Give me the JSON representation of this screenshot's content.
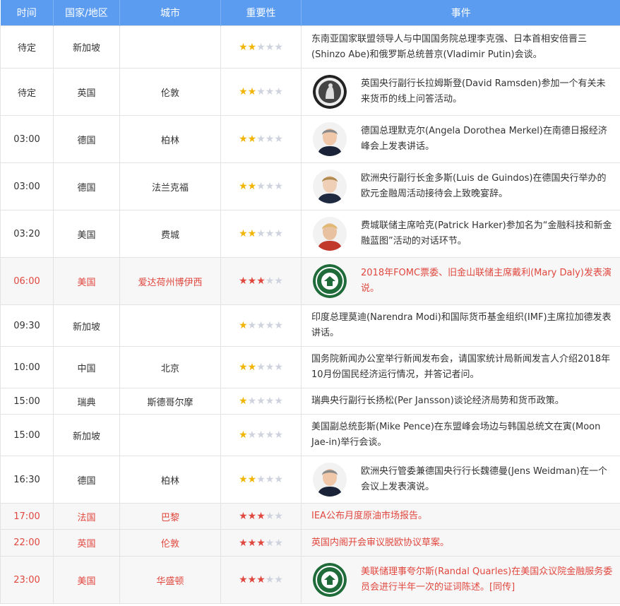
{
  "header": {
    "time": "时间",
    "country": "国家/地区",
    "city": "城市",
    "importance": "重要性",
    "event": "事件"
  },
  "colors": {
    "header_bg": "#5b9cf0",
    "highlight_text": "#e0473e",
    "star_yellow": "#f1b400",
    "star_red": "#e0473e",
    "star_gray": "#cfd3de"
  },
  "rows": [
    {
      "time": "待定",
      "country": "新加坡",
      "city": "",
      "stars": 2,
      "highlight": false,
      "avatar": "",
      "event": "东南亚国家联盟领导人与中国国务院总理李克强、日本首相安倍晋三(Shinzo Abe)和俄罗斯总统普京(Vladimir Putin)会谈。"
    },
    {
      "time": "待定",
      "country": "英国",
      "city": "伦敦",
      "stars": 2,
      "highlight": false,
      "avatar": "bank-of-england-logo-icon",
      "event": "英国央行副行长拉姆斯登(David Ramsden)参加一个有关未来货币的线上问答活动。"
    },
    {
      "time": "03:00",
      "country": "德国",
      "city": "柏林",
      "stars": 2,
      "highlight": false,
      "avatar": "person-photo-icon",
      "event": "德国总理默克尔(Angela Dorothea Merkel)在南德日报经济峰会上发表讲话。"
    },
    {
      "time": "03:00",
      "country": "德国",
      "city": "法兰克福",
      "stars": 2,
      "highlight": false,
      "avatar": "person-photo-icon",
      "event": "欧洲央行副行长金多斯(Luis de Guindos)在德国央行举办的欧元金融周活动接待会上致晚宴辞。"
    },
    {
      "time": "03:20",
      "country": "美国",
      "city": "费城",
      "stars": 2,
      "highlight": false,
      "avatar": "person-photo-icon",
      "event": "费城联储主席哈克(Patrick Harker)参加名为“金融科技和新金融蓝图”活动的对话环节。"
    },
    {
      "time": "06:00",
      "country": "美国",
      "city": "爱达荷州博伊西",
      "stars": 3,
      "highlight": true,
      "avatar": "federal-reserve-seal-icon",
      "event": "2018年FOMC票委、旧金山联储主席戴利(Mary Daly)发表演说。"
    },
    {
      "time": "09:30",
      "country": "新加坡",
      "city": "",
      "stars": 1,
      "highlight": false,
      "avatar": "",
      "event": "印度总理莫迪(Narendra Modi)和国际货币基金组织(IMF)主席拉加德发表讲话。"
    },
    {
      "time": "10:00",
      "country": "中国",
      "city": "北京",
      "stars": 2,
      "highlight": false,
      "avatar": "",
      "event": "国务院新闻办公室举行新闻发布会，请国家统计局新闻发言人介绍2018年10月份国民经济运行情况，并答记者问。"
    },
    {
      "time": "15:00",
      "country": "瑞典",
      "city": "斯德哥尔摩",
      "stars": 1,
      "highlight": false,
      "avatar": "",
      "event": "瑞典央行副行长扬松(Per Jansson)谈论经济局势和货币政策。"
    },
    {
      "time": "15:00",
      "country": "新加坡",
      "city": "",
      "stars": 1,
      "highlight": false,
      "avatar": "",
      "event": "美国副总统彭斯(Mike Pence)在东盟峰会场边与韩国总统文在寅(Moon Jae-in)举行会谈。"
    },
    {
      "time": "16:30",
      "country": "德国",
      "city": "柏林",
      "stars": 2,
      "highlight": false,
      "avatar": "person-photo-icon",
      "event": "欧洲央行管委兼德国央行行长魏德曼(Jens Weidman)在一个会议上发表演说。"
    },
    {
      "time": "17:00",
      "country": "法国",
      "city": "巴黎",
      "stars": 3,
      "highlight": true,
      "avatar": "",
      "event": "IEA公布月度原油市场报告。"
    },
    {
      "time": "22:00",
      "country": "英国",
      "city": "伦敦",
      "stars": 3,
      "highlight": true,
      "avatar": "",
      "event": "英国内阁开会审议脱欧协议草案。"
    },
    {
      "time": "23:00",
      "country": "美国",
      "city": "华盛顿",
      "stars": 3,
      "highlight": true,
      "avatar": "federal-reserve-seal-icon",
      "event": "美联储理事夸尔斯(Randal Quarles)在美国众议院金融服务委员会进行半年一次的证词陈述。[同传]"
    }
  ]
}
